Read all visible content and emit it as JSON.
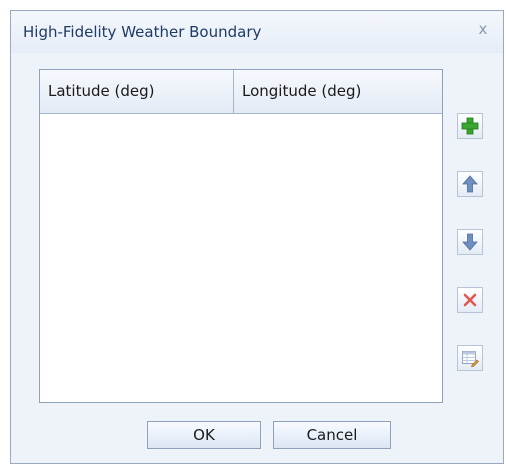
{
  "window": {
    "title": "High-Fidelity Weather Boundary",
    "close_glyph": "x"
  },
  "table": {
    "columns": [
      "Latitude (deg)",
      "Longitude (deg)"
    ],
    "rows": []
  },
  "side_buttons": [
    {
      "name": "add-row-button",
      "icon": "green-plus-icon"
    },
    {
      "name": "move-up-button",
      "icon": "arrow-up-icon"
    },
    {
      "name": "move-down-button",
      "icon": "arrow-down-icon"
    },
    {
      "name": "delete-row-button",
      "icon": "red-x-icon"
    },
    {
      "name": "edit-table-button",
      "icon": "table-edit-icon"
    }
  ],
  "footer": {
    "ok_label": "OK",
    "cancel_label": "Cancel"
  },
  "colors": {
    "title_text": "#1e3b63",
    "add_green": "#3aa62f",
    "arrow_blue": "#6e8fbf",
    "delete_red": "#e2584e"
  }
}
